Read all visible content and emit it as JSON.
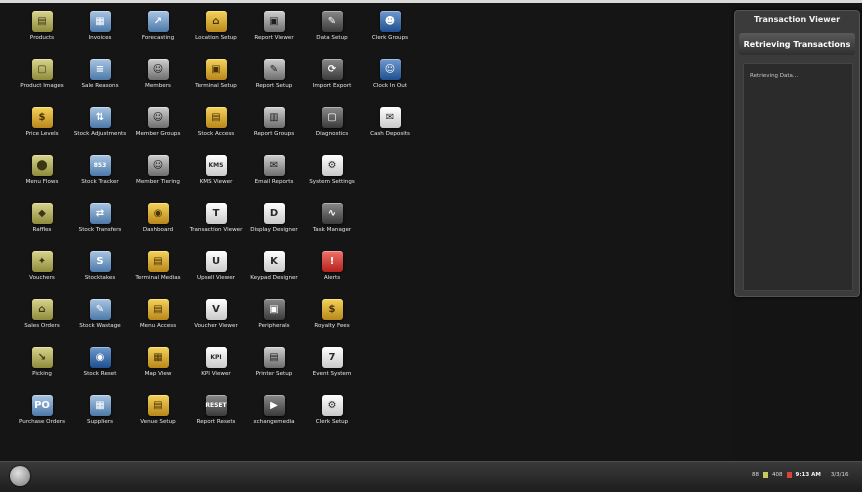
{
  "desktop": {
    "icons": [
      {
        "label": "Products",
        "glyph": "▤",
        "style": "g-olive",
        "icon": "products-icon"
      },
      {
        "label": "Invoices",
        "glyph": "▦",
        "style": "g-blue",
        "icon": "invoices-icon"
      },
      {
        "label": "Forecasting",
        "glyph": "↗",
        "style": "g-blue",
        "icon": "forecasting-icon"
      },
      {
        "label": "Location Setup",
        "glyph": "⌂",
        "style": "g-gold",
        "icon": "location-icon"
      },
      {
        "label": "Report Viewer",
        "glyph": "▣",
        "style": "g-gray",
        "icon": "report-viewer-icon"
      },
      {
        "label": "Data Setup",
        "glyph": "✎",
        "style": "g-dark",
        "icon": "wrench-icon"
      },
      {
        "label": "Clerk Groups",
        "glyph": "☻",
        "style": "g-navy",
        "icon": "clerk-groups-icon"
      },
      {
        "label": "Product Images",
        "glyph": "▢",
        "style": "g-olive",
        "icon": "product-images-icon"
      },
      {
        "label": "Sale Reasons",
        "glyph": "≡",
        "style": "g-blue",
        "icon": "sale-reasons-icon"
      },
      {
        "label": "Members",
        "glyph": "☺",
        "style": "g-gray",
        "icon": "members-icon"
      },
      {
        "label": "Terminal Setup",
        "glyph": "▣",
        "style": "g-gold",
        "icon": "terminal-icon"
      },
      {
        "label": "Report Setup",
        "glyph": "✎",
        "style": "g-gray",
        "icon": "report-setup-icon"
      },
      {
        "label": "Import Export",
        "glyph": "⟳",
        "style": "g-dark",
        "icon": "import-export-icon"
      },
      {
        "label": "Clock In Out",
        "glyph": "☺",
        "style": "g-navy",
        "icon": "clock-in-out-icon"
      },
      {
        "label": "Price Levels",
        "glyph": "$",
        "style": "g-gold",
        "icon": "price-levels-icon"
      },
      {
        "label": "Stock Adjustments",
        "glyph": "⇅",
        "style": "g-blue",
        "icon": "stock-adjust-icon"
      },
      {
        "label": "Member Groups",
        "glyph": "☺",
        "style": "g-gray",
        "icon": "member-groups-icon"
      },
      {
        "label": "Stock Access",
        "glyph": "▤",
        "style": "g-gold",
        "icon": "stock-access-icon"
      },
      {
        "label": "Report Groups",
        "glyph": "▥",
        "style": "g-gray",
        "icon": "report-groups-icon"
      },
      {
        "label": "Diagnostics",
        "glyph": "▢",
        "style": "g-dark",
        "icon": "diagnostics-icon"
      },
      {
        "label": "Cash Deposits",
        "glyph": "✉",
        "style": "g-white",
        "icon": "cash-deposits-icon"
      },
      {
        "label": "Menu Flows",
        "glyph": "⬤",
        "style": "g-olive",
        "icon": "menu-flows-icon"
      },
      {
        "label": "Stock Tracker",
        "glyph": "853",
        "style": "g-blue",
        "icon": "stock-tracker-icon"
      },
      {
        "label": "Member Tiering",
        "glyph": "☺",
        "style": "g-gray",
        "icon": "member-tiering-icon"
      },
      {
        "label": "KMS Viewer",
        "glyph": "KMS",
        "style": "g-white",
        "icon": "kms-viewer-icon"
      },
      {
        "label": "Email Reports",
        "glyph": "✉",
        "style": "g-gray",
        "icon": "email-reports-icon"
      },
      {
        "label": "System Settings",
        "glyph": "⚙",
        "style": "g-white",
        "icon": "gear-icon"
      },
      {
        "label": "",
        "glyph": "",
        "style": "",
        "icon": ""
      },
      {
        "label": "Raffles",
        "glyph": "◆",
        "style": "g-olive",
        "icon": "raffles-icon"
      },
      {
        "label": "Stock Transfers",
        "glyph": "⇄",
        "style": "g-blue",
        "icon": "stock-transfers-icon"
      },
      {
        "label": "Dashboard",
        "glyph": "◉",
        "style": "g-gold",
        "icon": "dashboard-icon"
      },
      {
        "label": "Transaction Viewer",
        "glyph": "T",
        "style": "g-white",
        "icon": "transaction-viewer-icon"
      },
      {
        "label": "Display Designer",
        "glyph": "D",
        "style": "g-white",
        "icon": "display-designer-icon"
      },
      {
        "label": "Task Manager",
        "glyph": "∿",
        "style": "g-dark",
        "icon": "task-manager-icon"
      },
      {
        "label": "",
        "glyph": "",
        "style": "",
        "icon": ""
      },
      {
        "label": "Vouchers",
        "glyph": "✦",
        "style": "g-olive",
        "icon": "vouchers-icon"
      },
      {
        "label": "Stocktakes",
        "glyph": "S",
        "style": "g-blue",
        "icon": "stocktakes-icon"
      },
      {
        "label": "Terminal Medias",
        "glyph": "▤",
        "style": "g-gold",
        "icon": "terminal-medias-icon"
      },
      {
        "label": "Upsell Viewer",
        "glyph": "U",
        "style": "g-white",
        "icon": "upsell-viewer-icon"
      },
      {
        "label": "Keypad Designer",
        "glyph": "K",
        "style": "g-white",
        "icon": "keypad-designer-icon"
      },
      {
        "label": "Alerts",
        "glyph": "!",
        "style": "g-red",
        "icon": "alerts-icon"
      },
      {
        "label": "",
        "glyph": "",
        "style": "",
        "icon": ""
      },
      {
        "label": "Sales Orders",
        "glyph": "⌂",
        "style": "g-olive",
        "icon": "sales-orders-icon"
      },
      {
        "label": "Stock Wastage",
        "glyph": "✎",
        "style": "g-blue",
        "icon": "stock-wastage-icon"
      },
      {
        "label": "Menu Access",
        "glyph": "▤",
        "style": "g-gold",
        "icon": "menu-access-icon"
      },
      {
        "label": "Voucher Viewer",
        "glyph": "V",
        "style": "g-white",
        "icon": "voucher-viewer-icon"
      },
      {
        "label": "Peripherals",
        "glyph": "▣",
        "style": "g-dark",
        "icon": "peripherals-icon"
      },
      {
        "label": "Royalty Fees",
        "glyph": "$",
        "style": "g-gold",
        "icon": "royalty-fees-icon"
      },
      {
        "label": "",
        "glyph": "",
        "style": "",
        "icon": ""
      },
      {
        "label": "Picking",
        "glyph": "↘",
        "style": "g-olive",
        "icon": "picking-icon"
      },
      {
        "label": "Stock Reset",
        "glyph": "◉",
        "style": "g-navy",
        "icon": "stock-reset-icon"
      },
      {
        "label": "Map View",
        "glyph": "▦",
        "style": "g-gold",
        "icon": "map-view-icon"
      },
      {
        "label": "KPI Viewer",
        "glyph": "KPI",
        "style": "g-white",
        "icon": "kpi-viewer-icon"
      },
      {
        "label": "Printer Setup",
        "glyph": "▤",
        "style": "g-gray",
        "icon": "printer-icon"
      },
      {
        "label": "Event System",
        "glyph": "7",
        "style": "g-white",
        "icon": "event-system-icon"
      },
      {
        "label": "",
        "glyph": "",
        "style": "",
        "icon": ""
      },
      {
        "label": "Purchase Orders",
        "glyph": "PO",
        "style": "g-blue",
        "icon": "purchase-orders-icon"
      },
      {
        "label": "Suppliers",
        "glyph": "▦",
        "style": "g-blue",
        "icon": "suppliers-icon"
      },
      {
        "label": "Venue Setup",
        "glyph": "▤",
        "style": "g-gold",
        "icon": "venue-setup-icon"
      },
      {
        "label": "Report Resets",
        "glyph": "RESET",
        "style": "g-dark",
        "icon": "report-resets-icon"
      },
      {
        "label": "xchangemedia",
        "glyph": "▶",
        "style": "g-dark",
        "icon": "xchangemedia-icon"
      },
      {
        "label": "Clerk Setup",
        "glyph": "⚙",
        "style": "g-white",
        "icon": "clerk-setup-icon"
      },
      {
        "label": "",
        "glyph": "",
        "style": "",
        "icon": ""
      }
    ]
  },
  "panel": {
    "title": "Transaction Viewer",
    "heading": "Retrieving Transactions",
    "status": "Retrieving Data..."
  },
  "taskbar": {
    "tray": {
      "left_count": "88",
      "mid_count": "408",
      "time": "9:13 AM",
      "date": "3/3/16"
    }
  }
}
